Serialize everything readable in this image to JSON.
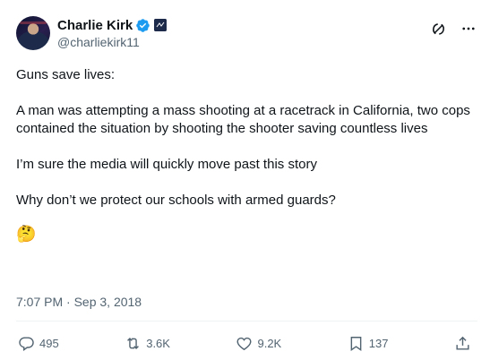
{
  "author": {
    "display_name": "Charlie Kirk",
    "handle": "@charliekirk11"
  },
  "tweet": {
    "paragraphs": [
      "Guns save lives:",
      "A man was attempting a mass shooting at a racetrack in California, two cops contained the situation by shooting the shooter saving countless lives",
      "I’m sure the media will quickly move past this story",
      "Why don’t we protect our schools with armed guards?"
    ],
    "emoji": "🤔",
    "timestamp": "7:07 PM · Sep 3, 2018"
  },
  "actions": {
    "replies": "495",
    "reposts": "3.6K",
    "likes": "9.2K",
    "bookmarks": "137"
  },
  "colors": {
    "verified": "#1d9bf0",
    "muted": "#536471",
    "text": "#0f1419"
  },
  "icons": [
    "verified-badge-icon",
    "affiliate-badge-icon",
    "grok-icon",
    "more-icon",
    "reply-icon",
    "repost-icon",
    "like-icon",
    "bookmark-icon",
    "share-icon"
  ]
}
